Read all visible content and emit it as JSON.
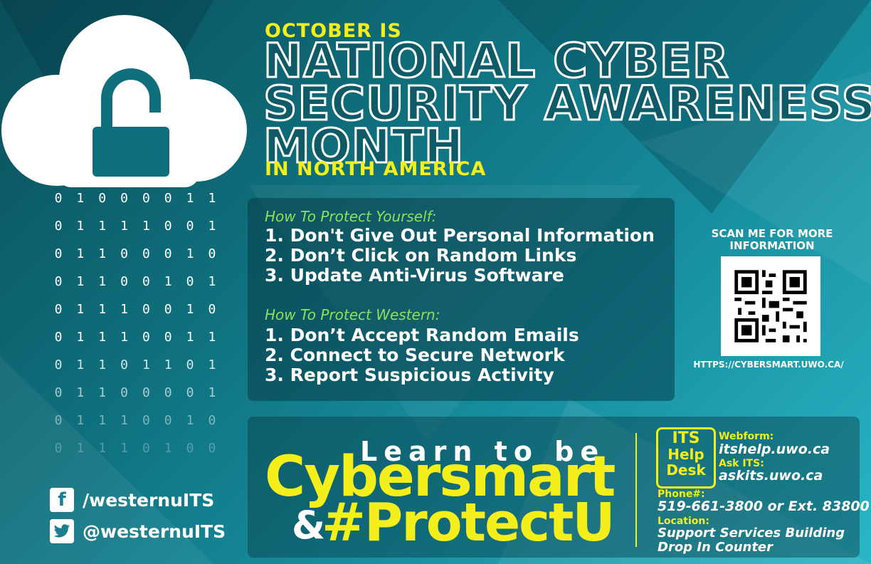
{
  "header": {
    "october_is": "OCTOBER IS",
    "title_lines": [
      "NATIONAL CYBER",
      "SECURITY AWARENESS",
      "MONTH"
    ],
    "in_north_america": "IN NORTH AMERICA"
  },
  "binary_rows": [
    "01000011",
    "01111001",
    "01100010",
    "01100101",
    "01110010",
    "01110011",
    "01101101",
    "01100001",
    "01110010",
    "01110100"
  ],
  "social": {
    "facebook": "/westernuITS",
    "twitter": "@westernuITS"
  },
  "protect_yourself": {
    "heading": "How To Protect Yourself:",
    "items": [
      "1. Don't Give Out Personal Information",
      "2. Don’t Click on Random Links",
      "3. Update Anti-Virus Software"
    ]
  },
  "protect_western": {
    "heading": "How To Protect Western:",
    "items": [
      "1. Don’t Accept Random Emails",
      "2. Connect to Secure Network",
      "3. Report Suspicious Activity"
    ]
  },
  "qr": {
    "scan_text": "SCAN ME FOR MORE INFORMATION",
    "url": "HTTPS://CYBERSMART.UWO.CA/"
  },
  "slogan": {
    "learn": "Learn to be",
    "cybersmart": "Cybersmart",
    "amp": "&",
    "protect": "#ProtectU"
  },
  "its": {
    "logo": [
      "ITS",
      "Help",
      "Desk"
    ],
    "webform_label": "Webform:",
    "webform_value": "itshelp.uwo.ca",
    "ask_label": "Ask ITS:",
    "ask_value": "askits.uwo.ca",
    "phone_label": "Phone#:",
    "phone_value": "519-661-3800 or Ext. 83800",
    "location_label": "Location:",
    "location_value_1": "Support Services Building",
    "location_value_2": "Drop In Counter"
  },
  "colors": {
    "accent_yellow": "#f4ef1b",
    "accent_green": "#8ee05c",
    "teal_dark": "#0e5a66"
  }
}
